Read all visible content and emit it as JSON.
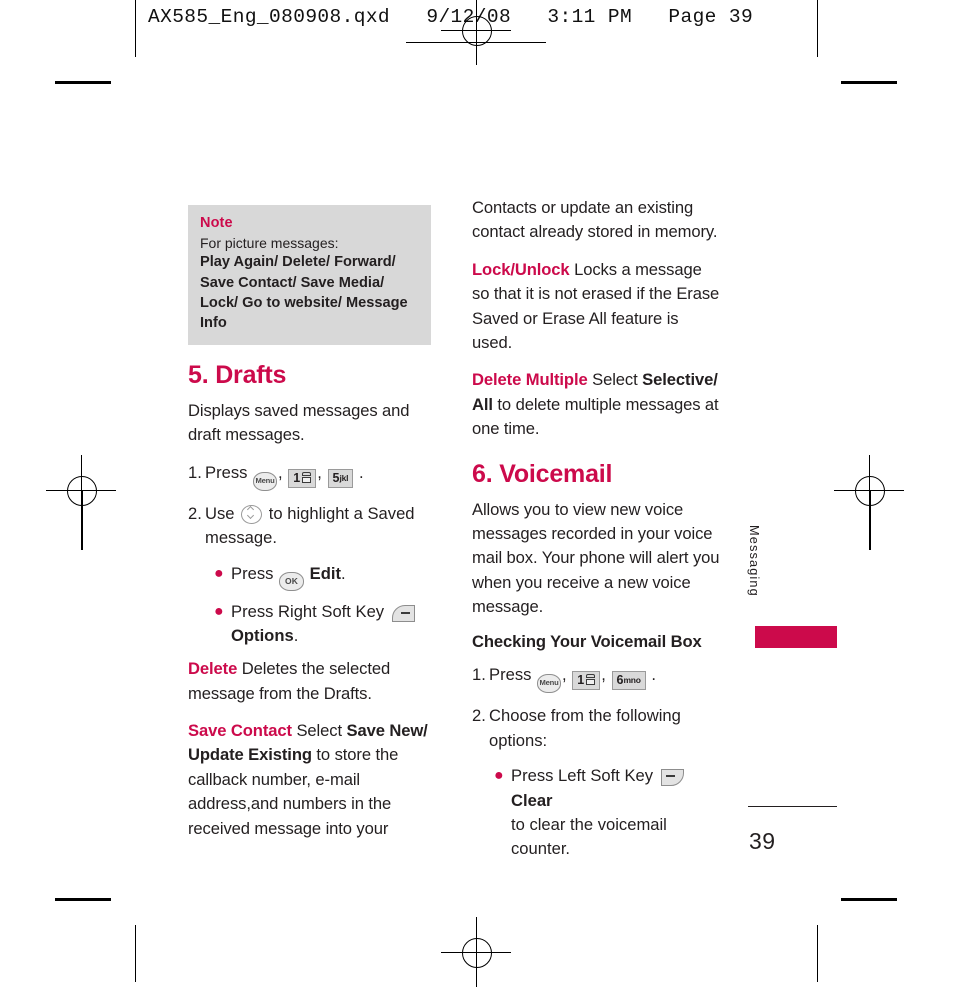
{
  "print_header": {
    "text": "AX585_Eng_080908.qxd   9/12/08   3:11 PM   Page 39"
  },
  "note": {
    "title": "Note",
    "subtitle": "For picture messages:",
    "options": "Play Again/ Delete/ Forward/ Save Contact/ Save Media/ Lock/ Go to  website/ Message Info"
  },
  "left_column": {
    "section_title": "5. Drafts",
    "intro": "Displays saved messages and draft messages.",
    "step1": {
      "number": "1.",
      "pre": "Press",
      "key_menu": "Menu",
      "key_1": "1",
      "key_5_digit": "5",
      "key_5_letters": "jkl",
      "sep": ",",
      "end": "."
    },
    "step2": {
      "number": "2.",
      "pre": "Use",
      "post": "to highlight a Saved message."
    },
    "bullets": [
      {
        "pre": "Press",
        "key": "OK",
        "bold": "Edit",
        "post": "."
      },
      {
        "pre": "Press Right Soft Key",
        "key": "right-soft-key",
        "bold": "Options",
        "post": "."
      }
    ],
    "delete": {
      "term": "Delete",
      "text": " Deletes the selected message from the Drafts."
    },
    "save_contact": {
      "term": "Save Contact",
      "mid": " Select ",
      "bold": "Save New/ Update Existing",
      "text": " to store the callback number, e-mail address,and numbers in the received message into your"
    }
  },
  "right_column": {
    "continuation": "Contacts or update an existing contact already stored in memory.",
    "lock_unlock": {
      "term": "Lock/Unlock",
      "text": " Locks a message so that it is not erased if the Erase Saved or Erase All feature is used."
    },
    "delete_multiple": {
      "term": "Delete Multiple",
      "mid": " Select ",
      "bold": "Selective/ All",
      "text": " to delete multiple messages at one time."
    },
    "section_title": "6. Voicemail",
    "intro": "Allows you to view new voice messages recorded in your voice mail box. Your phone will alert you when you receive a new voice message.",
    "subhead": "Checking Your Voicemail Box",
    "step1": {
      "number": "1.",
      "pre": "Press",
      "key_menu": "Menu",
      "key_1": "1",
      "key_6_digit": "6",
      "key_6_letters": "mno",
      "sep": ",",
      "end": "."
    },
    "step2": {
      "number": "2.",
      "text": "Choose from the following options:"
    },
    "bullet": {
      "pre": "Press Left Soft Key",
      "key": "left-soft-key",
      "bold": "Clear",
      "post": "to clear the voicemail counter."
    }
  },
  "side_tab": {
    "label": "Messaging"
  },
  "page_number": "39",
  "colors": {
    "accent": "#cc0a4b",
    "note_background": "#d8d8d8",
    "text": "#231f20",
    "key_face": "#d9d9d9"
  }
}
